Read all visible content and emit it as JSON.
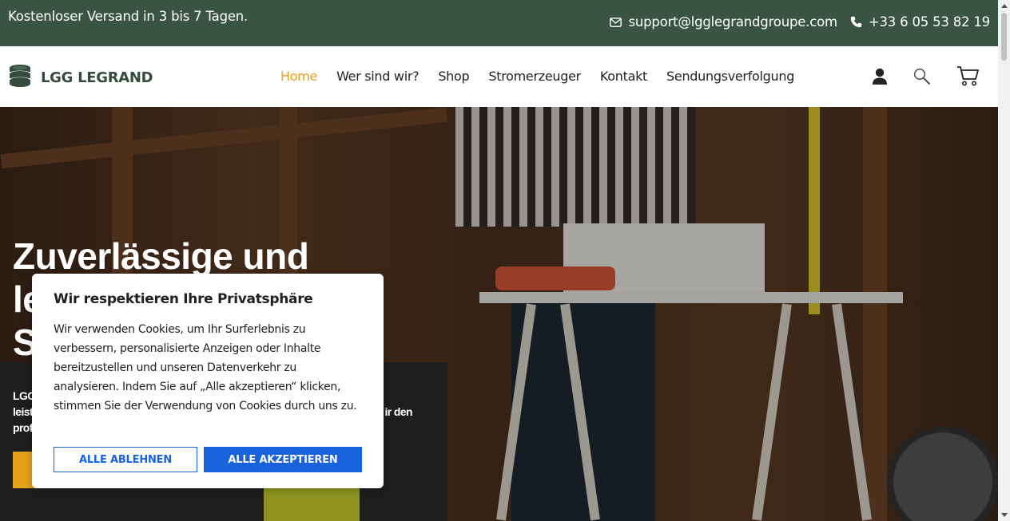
{
  "topbar": {
    "promo": "Kostenloser Versand in 3 bis 7 Tagen.",
    "email": "support@lgglegrandgroupe.com",
    "phone": "+33 6 05 53 82 19",
    "email_icon": "mail-icon",
    "phone_icon": "phone-icon"
  },
  "logo": {
    "text": "LGG LEGRAND",
    "icon": "coin-stack-icon"
  },
  "nav": {
    "items": [
      {
        "label": "Home",
        "active": true
      },
      {
        "label": "Wer sind wir?"
      },
      {
        "label": "Shop"
      },
      {
        "label": "Stromerzeuger"
      },
      {
        "label": "Kontakt"
      },
      {
        "label": "Sendungsverfolgung"
      }
    ]
  },
  "header_icons": [
    "user-icon",
    "search-icon",
    "cart-icon"
  ],
  "hero": {
    "title_line1": "Zuverlässige und",
    "title_line2": "le",
    "title_line3": "S",
    "text_line1": "LGG",
    "text_line2": "leist",
    "text_line2_end": "ir den",
    "text_line3": "prof"
  },
  "cookie": {
    "title": "Wir respektieren Ihre Privatsphäre",
    "body": "Wir verwenden Cookies, um Ihr Surferlebnis zu verbessern, personalisierte Anzeigen oder Inhalte bereitzustellen und unseren Datenverkehr zu analysieren. Indem Sie auf „Alle akzeptieren“ klicken, stimmen Sie der Verwendung von Cookies durch uns zu.",
    "reject_label": "ALLE ABLEHNEN",
    "accept_label": "ALLE AKZEPTIEREN"
  },
  "colors": {
    "topbar_bg": "#3a5443",
    "accent": "#e3a11b",
    "cookie_button": "#1863dc"
  }
}
